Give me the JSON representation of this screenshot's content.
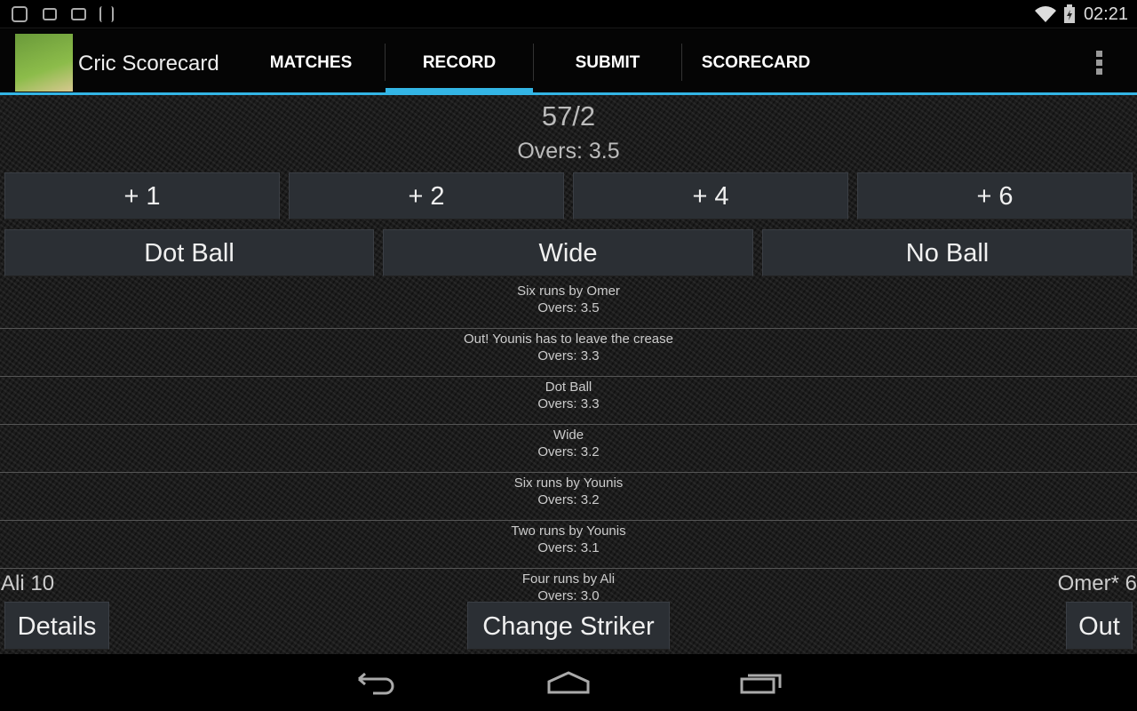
{
  "status_bar": {
    "time": "02:21",
    "icons": [
      "hangouts-icon",
      "gallery-icon",
      "outlook-icon",
      "barcode-icon",
      "wifi-icon",
      "battery-charging-icon"
    ]
  },
  "action_bar": {
    "title": "Cric Scorecard",
    "tabs": [
      {
        "label": "MATCHES"
      },
      {
        "label": "RECORD",
        "selected": true
      },
      {
        "label": "SUBMIT"
      },
      {
        "label": "SCORECARD"
      }
    ],
    "accent": "#33b5e5"
  },
  "score": {
    "total": "57/2",
    "overs": "Overs: 3.5"
  },
  "run_buttons": [
    "+ 1",
    "+ 2",
    "+ 4",
    "+ 6"
  ],
  "extra_buttons": [
    "Dot Ball",
    "Wide",
    "No Ball"
  ],
  "events": [
    {
      "text": "Six runs by Omer",
      "overs": "Overs: 3.5"
    },
    {
      "text": "Out! Younis has to leave the crease",
      "overs": "Overs: 3.3"
    },
    {
      "text": "Dot Ball",
      "overs": "Overs: 3.3"
    },
    {
      "text": "Wide",
      "overs": "Overs: 3.2"
    },
    {
      "text": "Six runs by Younis",
      "overs": "Overs: 3.2"
    },
    {
      "text": "Two runs by Younis",
      "overs": "Overs: 3.1"
    },
    {
      "text": "Four runs by Ali",
      "overs": "Overs: 3.0"
    }
  ],
  "players": {
    "left": "Ali 10",
    "right": "Omer* 6"
  },
  "bottom_buttons": {
    "details": "Details",
    "change_striker": "Change Striker",
    "out": "Out"
  }
}
